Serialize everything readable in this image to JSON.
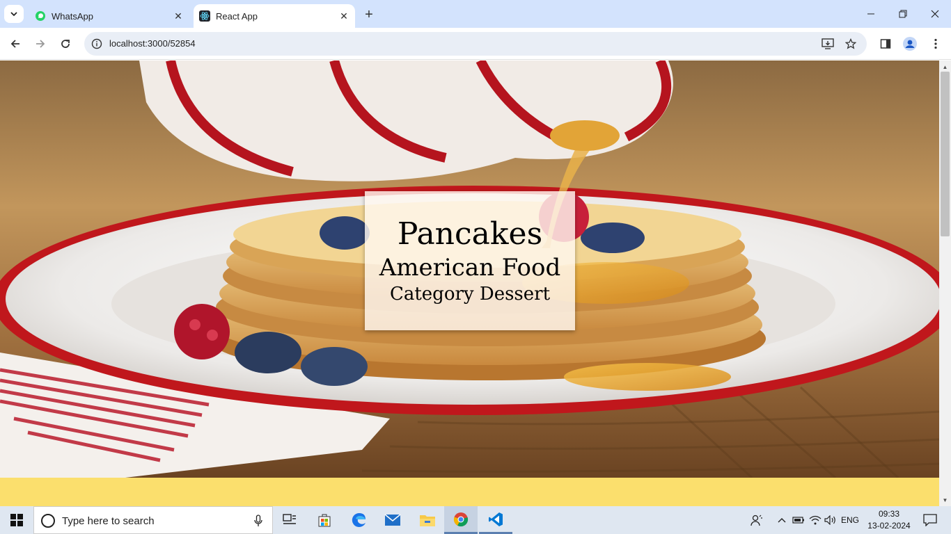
{
  "browser": {
    "tabs": [
      {
        "title": "WhatsApp",
        "favicon": "whatsapp-icon",
        "active": false
      },
      {
        "title": "React App",
        "favicon": "react-icon",
        "active": true
      }
    ],
    "url": "localhost:3000/52854"
  },
  "page": {
    "hero": {
      "meal": "Pancakes",
      "area": "American Food",
      "category": "Category Dessert",
      "image": "pancakes-photo"
    },
    "band_color": "#fbdf6d"
  },
  "taskbar": {
    "search_placeholder": "Type here to search",
    "apps": [
      "task-view-icon",
      "store-icon",
      "edge-icon",
      "mail-icon",
      "file-explorer-icon",
      "chrome-icon",
      "vscode-icon"
    ],
    "language": "ENG",
    "time": "09:33",
    "date": "13-02-2024"
  },
  "colors": {
    "tabstrip": "#d3e3fd",
    "omnibox": "#e9eef6",
    "accent_yellow": "#fbdf6d"
  }
}
